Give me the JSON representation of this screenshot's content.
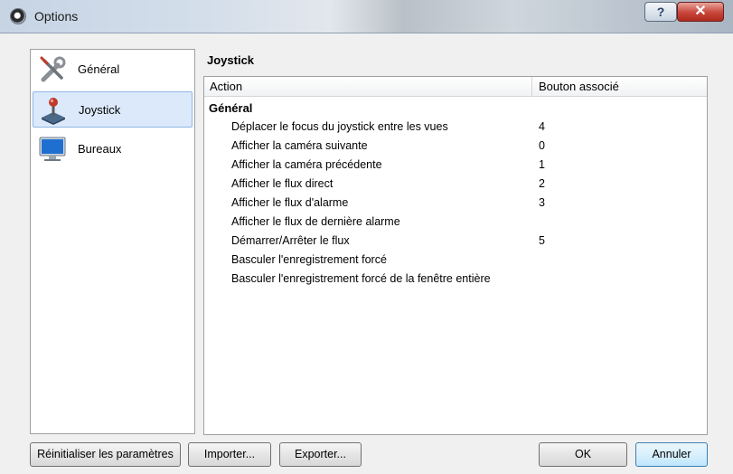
{
  "window": {
    "title": "Options"
  },
  "sidebar": {
    "items": [
      {
        "label": "Général",
        "icon": "tools-icon",
        "selected": false
      },
      {
        "label": "Joystick",
        "icon": "joystick-icon",
        "selected": true
      },
      {
        "label": "Bureaux",
        "icon": "monitor-icon",
        "selected": false
      }
    ]
  },
  "main": {
    "section_title": "Joystick",
    "columns": [
      "Action",
      "Bouton associé"
    ],
    "group_label": "Général",
    "rows": [
      {
        "action": "Déplacer le focus du joystick entre les vues",
        "button": "4"
      },
      {
        "action": "Afficher la caméra suivante",
        "button": "0"
      },
      {
        "action": "Afficher la caméra précédente",
        "button": "1"
      },
      {
        "action": "Afficher le flux direct",
        "button": "2"
      },
      {
        "action": "Afficher le flux d'alarme",
        "button": "3"
      },
      {
        "action": "Afficher le flux de dernière alarme",
        "button": ""
      },
      {
        "action": "Démarrer/Arrêter le flux",
        "button": "5"
      },
      {
        "action": "Basculer l'enregistrement forcé",
        "button": ""
      },
      {
        "action": "Basculer l'enregistrement forcé de la fenêtre entière",
        "button": ""
      }
    ]
  },
  "footer": {
    "reset_label": "Réinitialiser les paramètres",
    "import_label": "Importer...",
    "export_label": "Exporter...",
    "ok_label": "OK",
    "cancel_label": "Annuler"
  },
  "colors": {
    "selection": "#dbe9fb",
    "close_button": "#c8453a",
    "default_button_border": "#3c7fb1"
  }
}
